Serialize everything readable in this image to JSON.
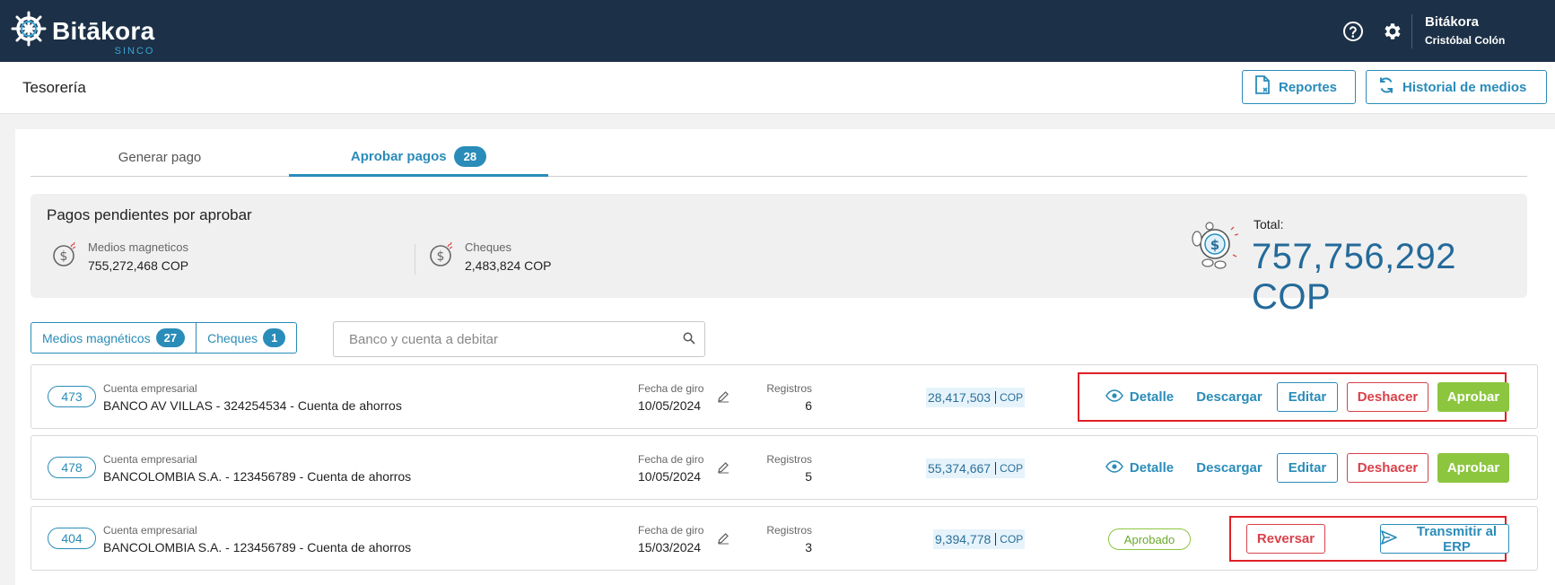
{
  "app": {
    "brand": "Bitākora",
    "brand_sub": "SINCO"
  },
  "user": {
    "company": "Bitákora",
    "name": "Cristóbal Colón"
  },
  "icons": {
    "help": "help-circle-icon",
    "settings": "gear-icon",
    "reports": "report-file-icon",
    "history": "refresh-icon",
    "search": "search-icon",
    "eye": "eye-icon",
    "edit": "pencil-icon",
    "send": "send-icon",
    "money": "money-icon"
  },
  "page": {
    "title": "Tesorería",
    "reports_label": "Reportes",
    "history_label": "Historial de medios"
  },
  "tabs": [
    {
      "label": "Generar pago"
    },
    {
      "label": "Aprobar pagos",
      "badge": "28"
    }
  ],
  "summary": {
    "title": "Pagos pendientes por aprobar",
    "medios": {
      "label": "Medios magneticos",
      "value": "755,272,468 COP"
    },
    "cheques": {
      "label": "Cheques",
      "value": "2,483,824 COP"
    },
    "total_label": "Total:",
    "total_value": "757,756,292 COP"
  },
  "filters": {
    "medios_label": "Medios magnéticos",
    "medios_count": "27",
    "cheques_label": "Cheques",
    "cheques_count": "1",
    "search_placeholder": "Banco y cuenta a debitar"
  },
  "labels": {
    "account": "Cuenta empresarial",
    "date": "Fecha de giro",
    "records": "Registros",
    "currency": "COP",
    "detail": "Detalle",
    "download": "Descargar",
    "edit": "Editar",
    "undo": "Deshacer",
    "approve": "Aprobar",
    "approved": "Aprobado",
    "reverse": "Reversar",
    "transmit": "Transmitir al ERP"
  },
  "rows": [
    {
      "id": "473",
      "account": "BANCO AV VILLAS - 324254534 - Cuenta de ahorros",
      "date": "10/05/2024",
      "records": "6",
      "amount": "28,417,503",
      "status": "pending"
    },
    {
      "id": "478",
      "account": "BANCOLOMBIA S.A. - 123456789 - Cuenta de ahorros",
      "date": "10/05/2024",
      "records": "5",
      "amount": "55,374,667",
      "status": "pending"
    },
    {
      "id": "404",
      "account": "BANCOLOMBIA S.A. - 123456789 - Cuenta de ahorros",
      "date": "15/03/2024",
      "records": "3",
      "amount": "9,394,778",
      "status": "approved"
    }
  ],
  "colors": {
    "topbar": "#1c3047",
    "accent": "#2a8cb9",
    "approve": "#8cc63f",
    "danger": "#d9414a",
    "highlight": "#e01f26"
  }
}
